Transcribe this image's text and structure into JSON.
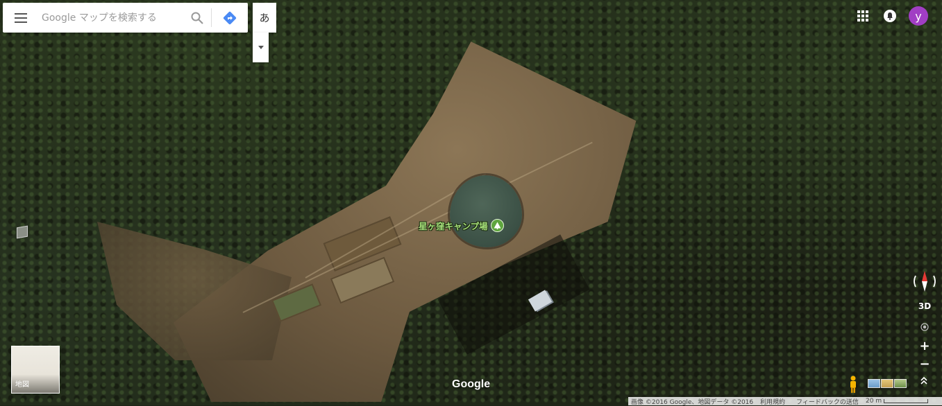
{
  "search": {
    "placeholder": "Google マップを検索する",
    "ime_label": "あ"
  },
  "map": {
    "poi_label": "星ヶ窪キャンプ場",
    "google_logo": "Google",
    "layer_card_label": "地図"
  },
  "controls": {
    "three_d_label": "3D",
    "zoom_in": "+",
    "zoom_out": "−"
  },
  "account": {
    "avatar_letter": "y",
    "avatar_color": "#a13ec4"
  },
  "footer": {
    "attribution": "画像 ©2016 Google、地図データ ©2016",
    "terms": "利用規約",
    "feedback": "フィードバックの送信",
    "scale": "20 m"
  },
  "icons": [
    "menu-icon",
    "search-icon",
    "directions-icon",
    "dropdown-arrow-icon",
    "apps-icon",
    "notifications-icon",
    "compass-icon",
    "my-location-icon",
    "pegman-icon",
    "expand-icon",
    "campground-icon"
  ]
}
